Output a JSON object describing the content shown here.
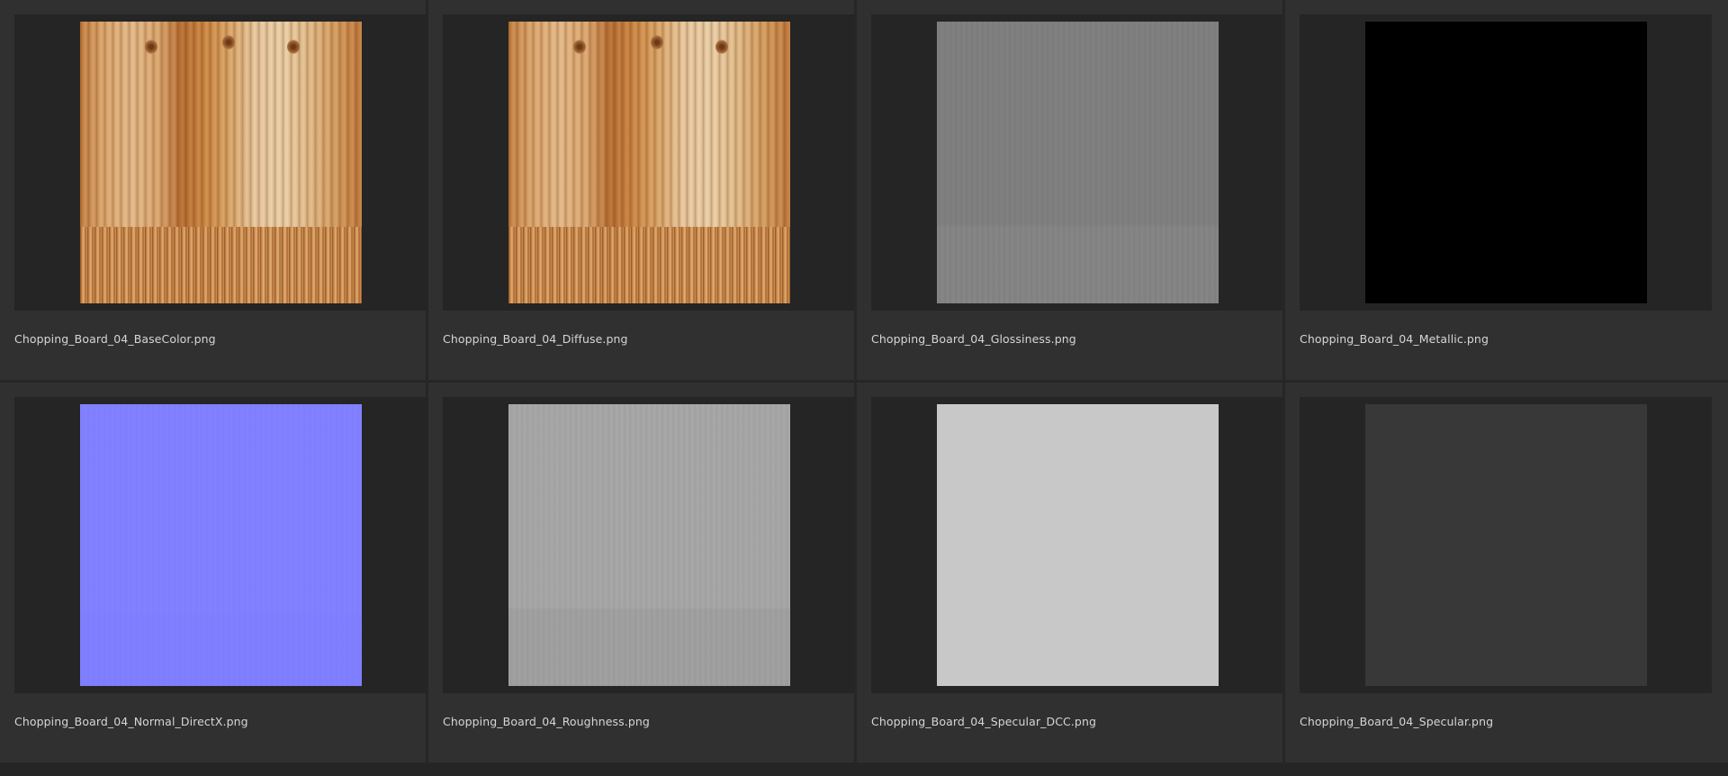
{
  "tiles": [
    {
      "filename": "Chopping_Board_04_BaseColor.png",
      "preview": "basecolor-texture",
      "color": "#d9a36a"
    },
    {
      "filename": "Chopping_Board_04_Diffuse.png",
      "preview": "diffuse-texture",
      "color": "#d9a36a"
    },
    {
      "filename": "Chopping_Board_04_Glossiness.png",
      "preview": "glossiness-texture",
      "color": "#7f7f7f"
    },
    {
      "filename": "Chopping_Board_04_Metallic.png",
      "preview": "metallic-texture",
      "color": "#000000"
    },
    {
      "filename": "Chopping_Board_04_Normal_DirectX.png",
      "preview": "normal-texture",
      "color": "#8080ff"
    },
    {
      "filename": "Chopping_Board_04_Roughness.png",
      "preview": "roughness-texture",
      "color": "#a6a6a6"
    },
    {
      "filename": "Chopping_Board_04_Specular_DCC.png",
      "preview": "specular-dcc-texture",
      "color": "#c8c8c8"
    },
    {
      "filename": "Chopping_Board_04_Specular.png",
      "preview": "specular-texture",
      "color": "#383838"
    }
  ],
  "colors": {
    "background": "#2b2b2b",
    "tile": "#303030",
    "frame": "#252525",
    "text": "#d6d6d6"
  }
}
